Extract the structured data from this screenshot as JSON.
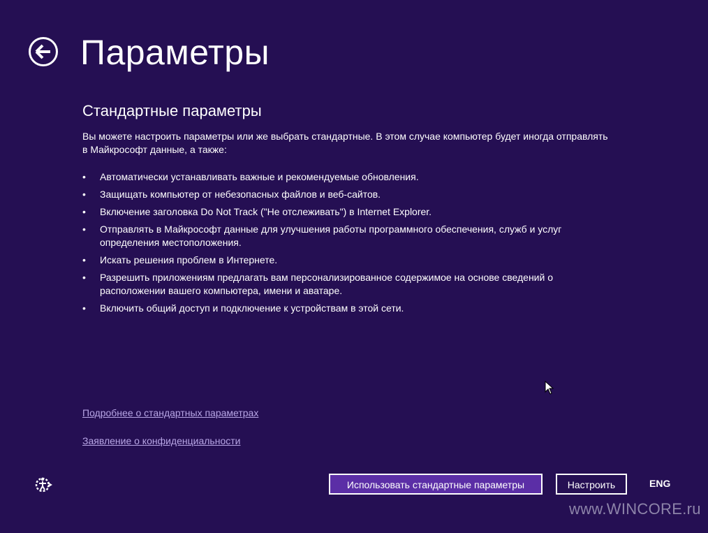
{
  "header": {
    "back_icon": "back-arrow-circle-icon",
    "title": "Параметры"
  },
  "main": {
    "section_title": "Стандартные параметры",
    "intro": "Вы можете настроить параметры или же выбрать стандартные. В этом случае компьютер будет иногда отправлять в Майкрософт данные, а также:",
    "bullet_char": "•",
    "bullets": [
      "Автоматически устанавливать важные и рекомендуемые обновления.",
      "Защищать компьютер от небезопасных файлов и веб-сайтов.",
      "Включение заголовка Do Not Track (\"Не отслеживать\") в Internet Explorer.",
      "Отправлять в Майкрософт данные для улучшения работы программного обеспечения, служб и услуг определения местоположения.",
      "Искать решения проблем в Интернете.",
      "Разрешить приложениям предлагать вам персонализированное содержимое на основе сведений о расположении вашего компьютера, имени и аватаре.",
      "Включить общий доступ и подключение к устройствам в этой сети."
    ],
    "links": {
      "learn_more": "Подробнее о стандартных параметрах",
      "privacy": "Заявление о конфиденциальности"
    }
  },
  "footer": {
    "accessibility_icon": "ease-of-access-icon",
    "use_defaults_label": "Использовать стандартные параметры",
    "customize_label": "Настроить",
    "language": "ENG",
    "watermark": "www.WINCORE.ru"
  },
  "colors": {
    "background": "#250f53",
    "primary_button": "#5b2ea6",
    "link": "#b8a6e6"
  }
}
